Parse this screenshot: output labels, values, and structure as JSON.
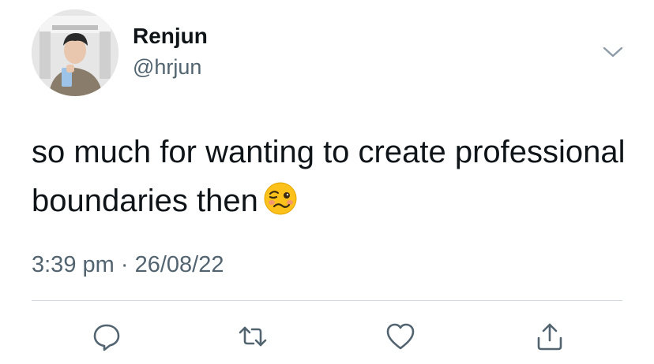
{
  "tweet": {
    "author": {
      "display_name": "Renjun",
      "handle": "@hrjun"
    },
    "text": "so much for wanting to create professional boundaries then",
    "emoji": "woozy-face",
    "time": "3:39 pm",
    "separator": "·",
    "date": "26/08/22"
  },
  "icons": {
    "menu": "chevron-down-icon",
    "actions": [
      "reply-icon",
      "retweet-icon",
      "like-icon",
      "share-icon"
    ]
  },
  "colors": {
    "text": "#0f1419",
    "secondary": "#536471",
    "divider": "#cfd9de",
    "icon": "#536471"
  }
}
